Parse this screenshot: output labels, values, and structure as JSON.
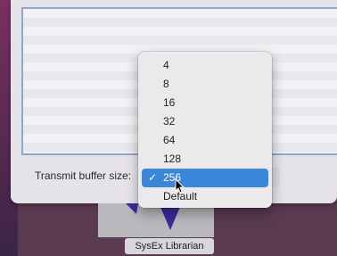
{
  "settings": {
    "buffer_label": "Transmit buffer size:"
  },
  "popup": {
    "check_glyph": "✓",
    "options": [
      "4",
      "8",
      "16",
      "32",
      "64",
      "128",
      "256",
      "Default"
    ],
    "selected_value": "256"
  },
  "dock": {
    "app_label": "SysEx Librarian"
  },
  "colors": {
    "selection": "#3a86d8",
    "app_icon": "#3a2a9a"
  }
}
